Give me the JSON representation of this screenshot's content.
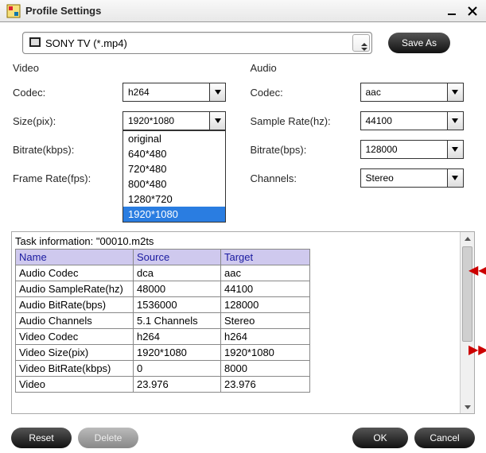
{
  "window": {
    "title": "Profile Settings"
  },
  "topbar": {
    "profile_text": "SONY TV (*.mp4)",
    "save_as": "Save As"
  },
  "video": {
    "title": "Video",
    "codec_label": "Codec:",
    "codec_value": "h264",
    "size_label": "Size(pix):",
    "size_value": "1920*1080",
    "size_options": [
      "original",
      "640*480",
      "720*480",
      "800*480",
      "1280*720",
      "1920*1080"
    ],
    "bitrate_label": "Bitrate(kbps):",
    "framerate_label": "Frame Rate(fps):"
  },
  "audio": {
    "title": "Audio",
    "codec_label": "Codec:",
    "codec_value": "aac",
    "sample_label": "Sample Rate(hz):",
    "sample_value": "44100",
    "bitrate_label": "Bitrate(bps):",
    "bitrate_value": "128000",
    "channels_label": "Channels:",
    "channels_value": "Stereo"
  },
  "task": {
    "label_prefix": "Task information: \"",
    "filename_partial": "00010.m2ts",
    "headers": {
      "name": "Name",
      "source": "Source",
      "target": "Target"
    },
    "rows": [
      {
        "name": "Audio Codec",
        "source": "dca",
        "target": "aac"
      },
      {
        "name": "Audio SampleRate(hz)",
        "source": "48000",
        "target": "44100"
      },
      {
        "name": "Audio BitRate(bps)",
        "source": "1536000",
        "target": "128000"
      },
      {
        "name": "Audio Channels",
        "source": "5.1 Channels",
        "target": "Stereo"
      },
      {
        "name": "Video Codec",
        "source": "h264",
        "target": "h264"
      },
      {
        "name": "Video Size(pix)",
        "source": "1920*1080",
        "target": "1920*1080"
      },
      {
        "name": "Video BitRate(kbps)",
        "source": "0",
        "target": "8000"
      },
      {
        "name": "Video",
        "source": "23.976",
        "target": "23.976"
      }
    ]
  },
  "buttons": {
    "reset": "Reset",
    "delete": "Delete",
    "ok": "OK",
    "cancel": "Cancel"
  }
}
